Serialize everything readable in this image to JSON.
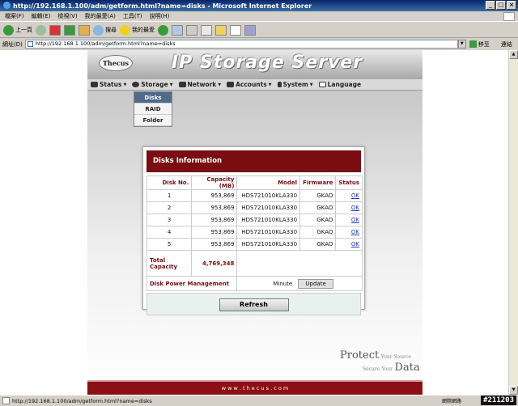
{
  "window": {
    "title": "http://192.168.1.100/adm/getform.html?name=disks - Microsoft Internet Explorer",
    "controls": [
      "_",
      "□",
      "×"
    ]
  },
  "menubar": {
    "items": [
      "檔案(F)",
      "編輯(E)",
      "檢視(V)",
      "我的最愛(A)",
      "工具(T)",
      "說明(H)"
    ]
  },
  "toolbar": {
    "back_label": "上一頁",
    "search_label": "搜尋",
    "favorites_label": "我的最愛"
  },
  "addressbar": {
    "label": "網址(D)",
    "url": "http://192.168.1.100/adm/getform.html?name=disks",
    "go_label": "移至",
    "links_label": "連結"
  },
  "page": {
    "brand": "Thecus",
    "server_title": "IP Storage Server",
    "nav": [
      {
        "label": "Status",
        "icon": "status-icon"
      },
      {
        "label": "Storage",
        "icon": "storage-icon"
      },
      {
        "label": "Network",
        "icon": "network-icon"
      },
      {
        "label": "Accounts",
        "icon": "accounts-icon"
      },
      {
        "label": "System",
        "icon": "system-icon"
      },
      {
        "label": "Language",
        "icon": "language-icon"
      }
    ],
    "submenu": [
      "Disks",
      "RAID",
      "Folder"
    ],
    "panel": {
      "title": "Disks Information",
      "columns": [
        "Disk No.",
        "Capacity (MB)",
        "Model",
        "Firmware",
        "Status"
      ],
      "rows": [
        {
          "no": "1",
          "capacity": "953,869",
          "model": "HDS721010KLA330",
          "firmware": "GKAO",
          "status": "OK"
        },
        {
          "no": "2",
          "capacity": "953,869",
          "model": "HDS721010KLA330",
          "firmware": "GKAO",
          "status": "OK"
        },
        {
          "no": "3",
          "capacity": "953,869",
          "model": "HDS721010KLA330",
          "firmware": "GKAO",
          "status": "OK"
        },
        {
          "no": "4",
          "capacity": "953,869",
          "model": "HDS721010KLA330",
          "firmware": "GKAO",
          "status": "OK"
        },
        {
          "no": "5",
          "capacity": "953,869",
          "model": "HDS721010KLA330",
          "firmware": "GKAO",
          "status": "OK"
        }
      ],
      "total_capacity_label": "Total Capacity",
      "total_capacity_value": "4,769,348",
      "power_mgmt_label": "Disk Power Management",
      "power_mgmt_unit": "Minute",
      "update_label": "Update",
      "refresh_label": "Refresh"
    },
    "tagline_big_1": "Protect",
    "tagline_small_1": "Your Source",
    "tagline_small_2": "Secure Your",
    "tagline_big_2": "Data",
    "footer": "w w w . t h e c u s . c o m"
  },
  "statusbar": {
    "url": "http://192.168.1.100/adm/getform.html?name=disks",
    "zone": "網際網路",
    "stamp": "#211203"
  }
}
